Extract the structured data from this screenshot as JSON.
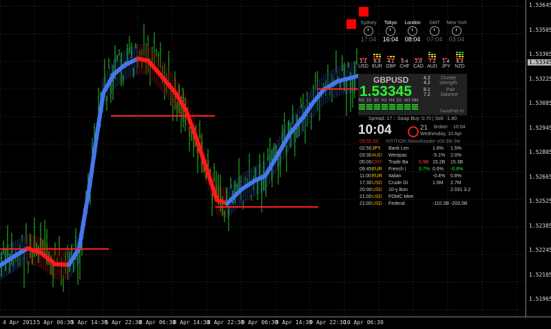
{
  "y_axis": {
    "labels": [
      "1.53645",
      "1.53505",
      "1.53365",
      "1.53225",
      "1.53085",
      "1.52945",
      "1.52805",
      "1.52665",
      "1.52525",
      "1.52385",
      "1.52245",
      "1.52105",
      "1.51965"
    ],
    "highlight": "1.53345"
  },
  "x_axis": {
    "labels": [
      "4 Apr 2013",
      "5 Apr 06:30",
      "5 Apr 14:30",
      "5 Apr 22:30",
      "8 Apr 06:30",
      "8 Apr 14:30",
      "8 Apr 22:30",
      "9 Apr 06:30",
      "9 Apr 14:30",
      "9 Apr 22:30",
      "10 Apr 06:30"
    ]
  },
  "clocks": [
    {
      "name": "Sydney",
      "time": "17:04",
      "active": false
    },
    {
      "name": "Tokyo",
      "time": "16:04",
      "active": true
    },
    {
      "name": "London",
      "time": "08:04",
      "active": true
    },
    {
      "name": "GMT",
      "time": "07:04",
      "active": false
    },
    {
      "name": "New York",
      "time": "03:04",
      "active": false
    }
  ],
  "currency_strength": [
    {
      "value": "2.1",
      "ccy": "USD"
    },
    {
      "value": "6.3",
      "ccy": "EUR"
    },
    {
      "value": "4.1",
      "ccy": "GBP"
    },
    {
      "value": "0.4",
      "ccy": "CHF"
    },
    {
      "value": "2.0",
      "ccy": "CAD"
    },
    {
      "value": "7.2",
      "ccy": "AUD"
    },
    {
      "value": "1.4",
      "ccy": "JPY"
    },
    {
      "value": "8.3",
      "ccy": "NZD"
    }
  ],
  "symbol": "GBPUSD",
  "price": "1.53345",
  "cluster": {
    "v1": "4.2",
    "v2": "4.2",
    "label1": "Cluster",
    "label2": "strength"
  },
  "pair_balance": {
    "v1": "8.1",
    "v2": "7.2",
    "label1": "Pair",
    "label2": "balance"
  },
  "timeframes": [
    "M1",
    "15",
    "30",
    "H1",
    "H4",
    "D1",
    "W1",
    "MN"
  ],
  "trend_label": "TrendPrint VI",
  "spread_line": "Spread: 17  ::  Swap Buy: 0.70  |  Sell: -1.80",
  "broker_time": "10:04",
  "day_num": "21",
  "broker_label": "broker",
  "broker_clock": "10:04",
  "broker_date": "Wednesday, 10 Apr",
  "countdown": "09:55:55",
  "newsreader": "INTITION NewsReader v09.99r lite",
  "news": [
    {
      "time": "02:50",
      "ccy": "JPY",
      "ccy_color": "#ffd700",
      "event": "Bank Len",
      "a": "",
      "f": "1.8%",
      "p": "1.5%"
    },
    {
      "time": "03:30",
      "ccy": "AUD",
      "ccy_color": "#ffa500",
      "event": "Westpac",
      "a": "",
      "f": "-5.1%",
      "p": "2.0%"
    },
    {
      "time": "05:00",
      "ccy": "CNY",
      "ccy_color": "#ff3030",
      "event": "Trade Ba",
      "a": "0.9B",
      "f": "15.2B",
      "p": "15.3B"
    },
    {
      "time": "09:45",
      "ccy": "EUR",
      "ccy_color": "#ffd700",
      "event": "French I",
      "a": "0.7%",
      "f": "0.6%",
      "p": "-0.8%"
    },
    {
      "time": "11:00",
      "ccy": "EUR",
      "ccy_color": "#ffd700",
      "event": "Italian",
      "a": "",
      "f": "-0.4%",
      "p": "0.8%"
    },
    {
      "time": "17:30",
      "ccy": "USD",
      "ccy_color": "#ffa500",
      "event": "Crude Oi",
      "a": "",
      "f": "1.6M",
      "p": "2.7M"
    },
    {
      "time": "20:00",
      "ccy": "USD",
      "ccy_color": "#ffa500",
      "event": "10-y Bon",
      "a": "",
      "f": "",
      "p": "2.031 3.2"
    },
    {
      "time": "21:00",
      "ccy": "USD",
      "ccy_color": "#ffa500",
      "event": "FOMC Mee",
      "a": "",
      "f": "",
      "p": ""
    },
    {
      "time": "21:00",
      "ccy": "USD",
      "ccy_color": "#ffa500",
      "event": "Federal",
      "a": "",
      "f": "-110.3B",
      "p": "-203.5B"
    }
  ],
  "colors": {
    "bull": "#22cc22",
    "bear": "#ff1a1a",
    "ma_up": "#4477ee",
    "price_green": "#2ef22e",
    "background": "#000000",
    "grid": "#3a3a3a"
  }
}
